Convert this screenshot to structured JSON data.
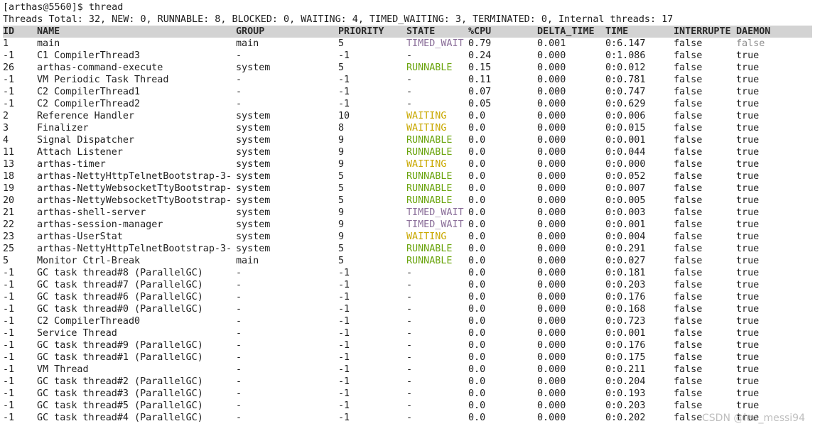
{
  "prompt": "[arthas@5560]$ thread",
  "summary": "Threads Total: 32, NEW: 0, RUNNABLE: 8, BLOCKED: 0, WAITING: 4, TIMED_WAITING: 3, TERMINATED: 0, Internal threads: 17",
  "columns": [
    "ID",
    "NAME",
    "GROUP",
    "PRIORITY",
    "STATE",
    "%CPU",
    "DELTA_TIME",
    "TIME",
    "INTERRUPTE",
    "DAEMON"
  ],
  "colors": {
    "timed_wait": "#8a6e99",
    "runnable": "#6aa40d",
    "waiting": "#c9a800",
    "header_bg": "#d3d3d3"
  },
  "rows": [
    [
      "1",
      "main",
      "main",
      "5",
      "TIMED_WAIT",
      "0.79",
      "0.001",
      "0:6.147",
      "false",
      "false"
    ],
    [
      "-1",
      "C1 CompilerThread3",
      "-",
      "-1",
      "-",
      "0.24",
      "0.000",
      "0:1.086",
      "false",
      "true"
    ],
    [
      "26",
      "arthas-command-execute",
      "system",
      "5",
      "RUNNABLE",
      "0.15",
      "0.000",
      "0:0.012",
      "false",
      "true"
    ],
    [
      "-1",
      "VM Periodic Task Thread",
      "-",
      "-1",
      "-",
      "0.11",
      "0.000",
      "0:0.781",
      "false",
      "true"
    ],
    [
      "-1",
      "C2 CompilerThread1",
      "-",
      "-1",
      "-",
      "0.07",
      "0.000",
      "0:0.747",
      "false",
      "true"
    ],
    [
      "-1",
      "C2 CompilerThread2",
      "-",
      "-1",
      "-",
      "0.05",
      "0.000",
      "0:0.629",
      "false",
      "true"
    ],
    [
      "2",
      "Reference Handler",
      "system",
      "10",
      "WAITING",
      "0.0",
      "0.000",
      "0:0.006",
      "false",
      "true"
    ],
    [
      "3",
      "Finalizer",
      "system",
      "8",
      "WAITING",
      "0.0",
      "0.000",
      "0:0.015",
      "false",
      "true"
    ],
    [
      "4",
      "Signal Dispatcher",
      "system",
      "9",
      "RUNNABLE",
      "0.0",
      "0.000",
      "0:0.001",
      "false",
      "true"
    ],
    [
      "11",
      "Attach Listener",
      "system",
      "9",
      "RUNNABLE",
      "0.0",
      "0.000",
      "0:0.044",
      "false",
      "true"
    ],
    [
      "13",
      "arthas-timer",
      "system",
      "9",
      "WAITING",
      "0.0",
      "0.000",
      "0:0.000",
      "false",
      "true"
    ],
    [
      "18",
      "arthas-NettyHttpTelnetBootstrap-3-",
      "system",
      "5",
      "RUNNABLE",
      "0.0",
      "0.000",
      "0:0.052",
      "false",
      "true"
    ],
    [
      "19",
      "arthas-NettyWebsocketTtyBootstrap-",
      "system",
      "5",
      "RUNNABLE",
      "0.0",
      "0.000",
      "0:0.007",
      "false",
      "true"
    ],
    [
      "20",
      "arthas-NettyWebsocketTtyBootstrap-",
      "system",
      "5",
      "RUNNABLE",
      "0.0",
      "0.000",
      "0:0.005",
      "false",
      "true"
    ],
    [
      "21",
      "arthas-shell-server",
      "system",
      "9",
      "TIMED_WAIT",
      "0.0",
      "0.000",
      "0:0.003",
      "false",
      "true"
    ],
    [
      "22",
      "arthas-session-manager",
      "system",
      "9",
      "TIMED_WAIT",
      "0.0",
      "0.000",
      "0:0.001",
      "false",
      "true"
    ],
    [
      "23",
      "arthas-UserStat",
      "system",
      "9",
      "WAITING",
      "0.0",
      "0.000",
      "0:0.004",
      "false",
      "true"
    ],
    [
      "25",
      "arthas-NettyHttpTelnetBootstrap-3-",
      "system",
      "5",
      "RUNNABLE",
      "0.0",
      "0.000",
      "0:0.291",
      "false",
      "true"
    ],
    [
      "5",
      "Monitor Ctrl-Break",
      "main",
      "5",
      "RUNNABLE",
      "0.0",
      "0.000",
      "0:0.027",
      "false",
      "true"
    ],
    [
      "-1",
      "GC task thread#8 (ParallelGC)",
      "-",
      "-1",
      "-",
      "0.0",
      "0.000",
      "0:0.181",
      "false",
      "true"
    ],
    [
      "-1",
      "GC task thread#7 (ParallelGC)",
      "-",
      "-1",
      "-",
      "0.0",
      "0.000",
      "0:0.203",
      "false",
      "true"
    ],
    [
      "-1",
      "GC task thread#6 (ParallelGC)",
      "-",
      "-1",
      "-",
      "0.0",
      "0.000",
      "0:0.176",
      "false",
      "true"
    ],
    [
      "-1",
      "GC task thread#0 (ParallelGC)",
      "-",
      "-1",
      "-",
      "0.0",
      "0.000",
      "0:0.168",
      "false",
      "true"
    ],
    [
      "-1",
      "C2 CompilerThread0",
      "-",
      "-1",
      "-",
      "0.0",
      "0.000",
      "0:0.723",
      "false",
      "true"
    ],
    [
      "-1",
      "Service Thread",
      "-",
      "-1",
      "-",
      "0.0",
      "0.000",
      "0:0.001",
      "false",
      "true"
    ],
    [
      "-1",
      "GC task thread#9 (ParallelGC)",
      "-",
      "-1",
      "-",
      "0.0",
      "0.000",
      "0:0.176",
      "false",
      "true"
    ],
    [
      "-1",
      "GC task thread#1 (ParallelGC)",
      "-",
      "-1",
      "-",
      "0.0",
      "0.000",
      "0:0.175",
      "false",
      "true"
    ],
    [
      "-1",
      "VM Thread",
      "-",
      "-1",
      "-",
      "0.0",
      "0.000",
      "0:0.211",
      "false",
      "true"
    ],
    [
      "-1",
      "GC task thread#2 (ParallelGC)",
      "-",
      "-1",
      "-",
      "0.0",
      "0.000",
      "0:0.204",
      "false",
      "true"
    ],
    [
      "-1",
      "GC task thread#3 (ParallelGC)",
      "-",
      "-1",
      "-",
      "0.0",
      "0.000",
      "0:0.193",
      "false",
      "true"
    ],
    [
      "-1",
      "GC task thread#5 (ParallelGC)",
      "-",
      "-1",
      "-",
      "0.0",
      "0.000",
      "0:0.203",
      "false",
      "true"
    ],
    [
      "-1",
      "GC task thread#4 (ParallelGC)",
      "-",
      "-1",
      "-",
      "0.0",
      "0.000",
      "0:0.202",
      "false",
      "true"
    ]
  ],
  "watermark": "CSDN @leo_messi94"
}
